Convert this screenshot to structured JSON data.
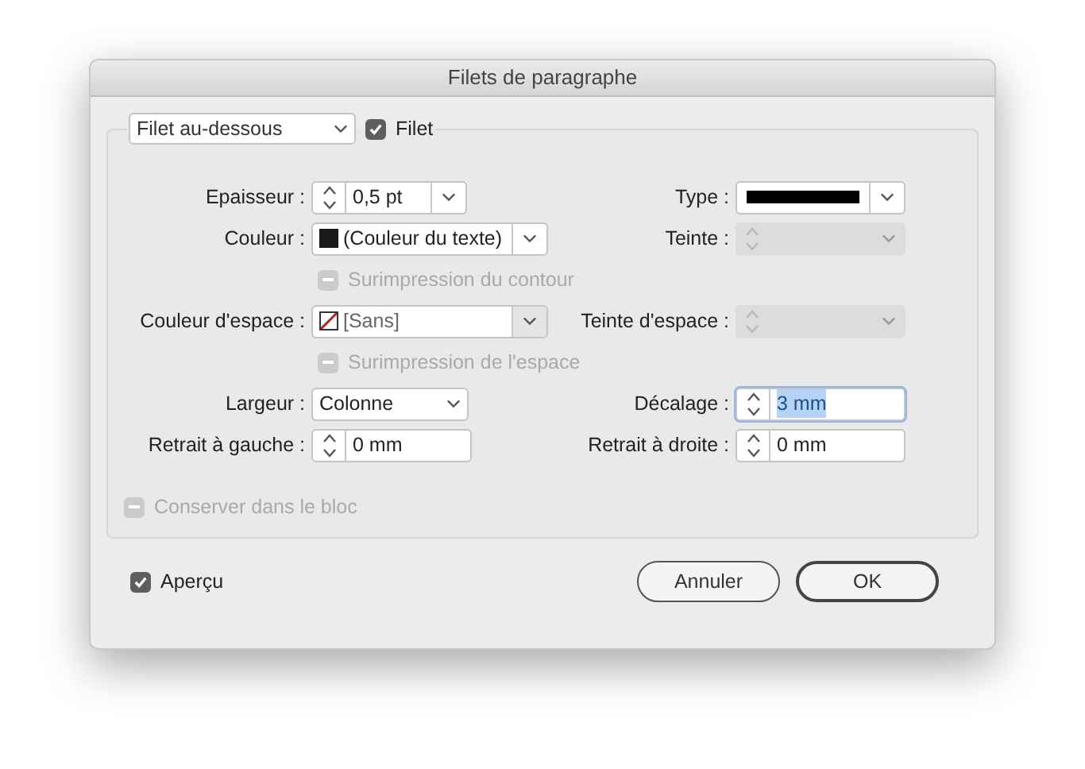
{
  "window": {
    "title": "Filets de paragraphe"
  },
  "rule_select": {
    "value": "Filet au-dessous"
  },
  "rule_checkbox": {
    "label": "Filet",
    "checked": true
  },
  "rows": [
    {
      "kind": "pair",
      "left": {
        "label": "Epaisseur :",
        "kind": "spin_combo",
        "value": "0,5 pt",
        "disabled": false
      },
      "right": {
        "label": "Type :",
        "kind": "stroke_select",
        "disabled": false
      }
    },
    {
      "kind": "pair",
      "left": {
        "label": "Couleur :",
        "kind": "swatch_select",
        "no_color": false,
        "value": "(Couleur du texte)",
        "disabled": false
      },
      "right": {
        "label": "Teinte :",
        "kind": "spin_combo",
        "disabled": true
      }
    },
    {
      "kind": "checkbox",
      "label": "Surimpression du contour",
      "checked": false,
      "indeterminate": true,
      "disabled": true
    },
    {
      "kind": "pair",
      "left": {
        "label": "Couleur d'espace :",
        "kind": "swatch_select",
        "no_color": true,
        "value": "[Sans]",
        "disabled": false
      },
      "right": {
        "label": "Teinte d'espace :",
        "kind": "spin_combo",
        "disabled": true
      }
    },
    {
      "kind": "checkbox",
      "label": "Surimpression de l'espace",
      "checked": false,
      "indeterminate": true,
      "disabled": true
    },
    {
      "kind": "pair",
      "left": {
        "label": "Largeur :",
        "kind": "select",
        "value": "Colonne",
        "disabled": false
      },
      "right": {
        "label": "Décalage :",
        "kind": "spin",
        "value": "3 mm",
        "disabled": false,
        "focused": true
      }
    },
    {
      "kind": "pair",
      "left": {
        "label": "Retrait à gauche :",
        "kind": "spin",
        "value": "0 mm",
        "disabled": false,
        "focused": false
      },
      "right": {
        "label": "Retrait à droite :",
        "kind": "spin",
        "value": "0 mm",
        "disabled": false,
        "focused": false
      }
    }
  ],
  "keep_checkbox": {
    "label": "Conserver dans le bloc",
    "checked": false,
    "indeterminate": true,
    "disabled": true
  },
  "preview_checkbox": {
    "label": "Aperçu",
    "checked": true
  },
  "buttons": [
    {
      "label": "Annuler",
      "default": false
    },
    {
      "label": "OK",
      "default": true
    }
  ]
}
